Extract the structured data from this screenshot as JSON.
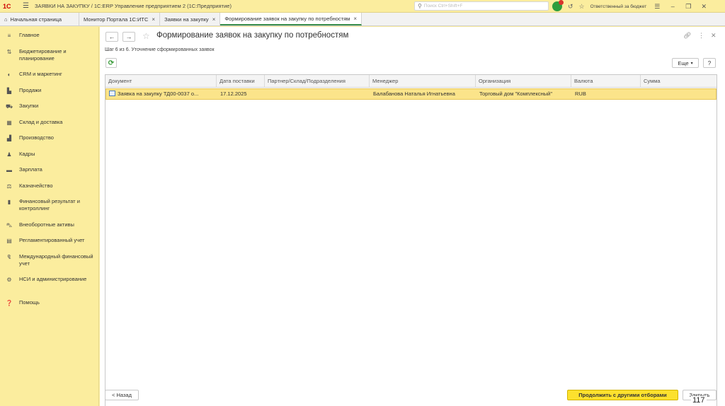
{
  "titlebar": {
    "logo": "1С",
    "title": "ЗАЯВКИ НА ЗАКУПКУ / 1С:ERP Управление предприятием 2  (1С:Предприятие)",
    "search_placeholder": "Поиск Ctrl+Shift+F",
    "user": "Ответственный за бюджет"
  },
  "tabs": [
    {
      "label": "Начальная страница"
    },
    {
      "label": "Монитор Портала 1С:ИТС"
    },
    {
      "label": "Заявки на закупку"
    },
    {
      "label": "Формирование заявок на закупку по потребностям"
    }
  ],
  "sidebar": {
    "items": [
      {
        "label": "Главное",
        "icon": "menu-lines-icon"
      },
      {
        "label": "Бюджетирование и планирование",
        "icon": "budget-icon"
      },
      {
        "label": "CRM и маркетинг",
        "icon": "crm-icon"
      },
      {
        "label": "Продажи",
        "icon": "sales-icon"
      },
      {
        "label": "Закупки",
        "icon": "cart-icon"
      },
      {
        "label": "Склад и доставка",
        "icon": "warehouse-icon"
      },
      {
        "label": "Производство",
        "icon": "factory-icon"
      },
      {
        "label": "Кадры",
        "icon": "person-icon"
      },
      {
        "label": "Зарплата",
        "icon": "salary-icon"
      },
      {
        "label": "Казначейство",
        "icon": "treasury-icon"
      },
      {
        "label": "Финансовый результат и контроллинг",
        "icon": "chart-icon"
      },
      {
        "label": "Внеоборотные активы",
        "icon": "car-icon"
      },
      {
        "label": "Регламентированный учет",
        "icon": "ledger-icon"
      },
      {
        "label": "Международный финансовый учет",
        "icon": "international-icon"
      },
      {
        "label": "НСИ и администрирование",
        "icon": "gear-icon"
      },
      {
        "label": "Помощь",
        "icon": "help-icon"
      }
    ]
  },
  "form": {
    "title": "Формирование заявок на закупку по потребностям",
    "step": "Шаг 6 из 6. Уточнение сформированных заявок",
    "more_label": "Еще",
    "help_label": "?"
  },
  "table": {
    "columns": [
      "Документ",
      "Дата поставки",
      "Партнер/Склад/Подразделения",
      "Менеджер",
      "Организация",
      "Валюта",
      "Сумма"
    ],
    "rows": [
      {
        "document": "Заявка на закупку ТД00-0037 о...",
        "date": "17.12.2025",
        "partner": "",
        "manager": "Балабанова Наталья Игнатьевна",
        "organization": "Торговый дом \"Комплексный\"",
        "currency": "RUB",
        "sum": ""
      }
    ]
  },
  "footer": {
    "back_label": "< Назад",
    "continue_label": "Продолжить с другими отборами",
    "close_label": "Закрыть"
  },
  "slide_number": "117"
}
